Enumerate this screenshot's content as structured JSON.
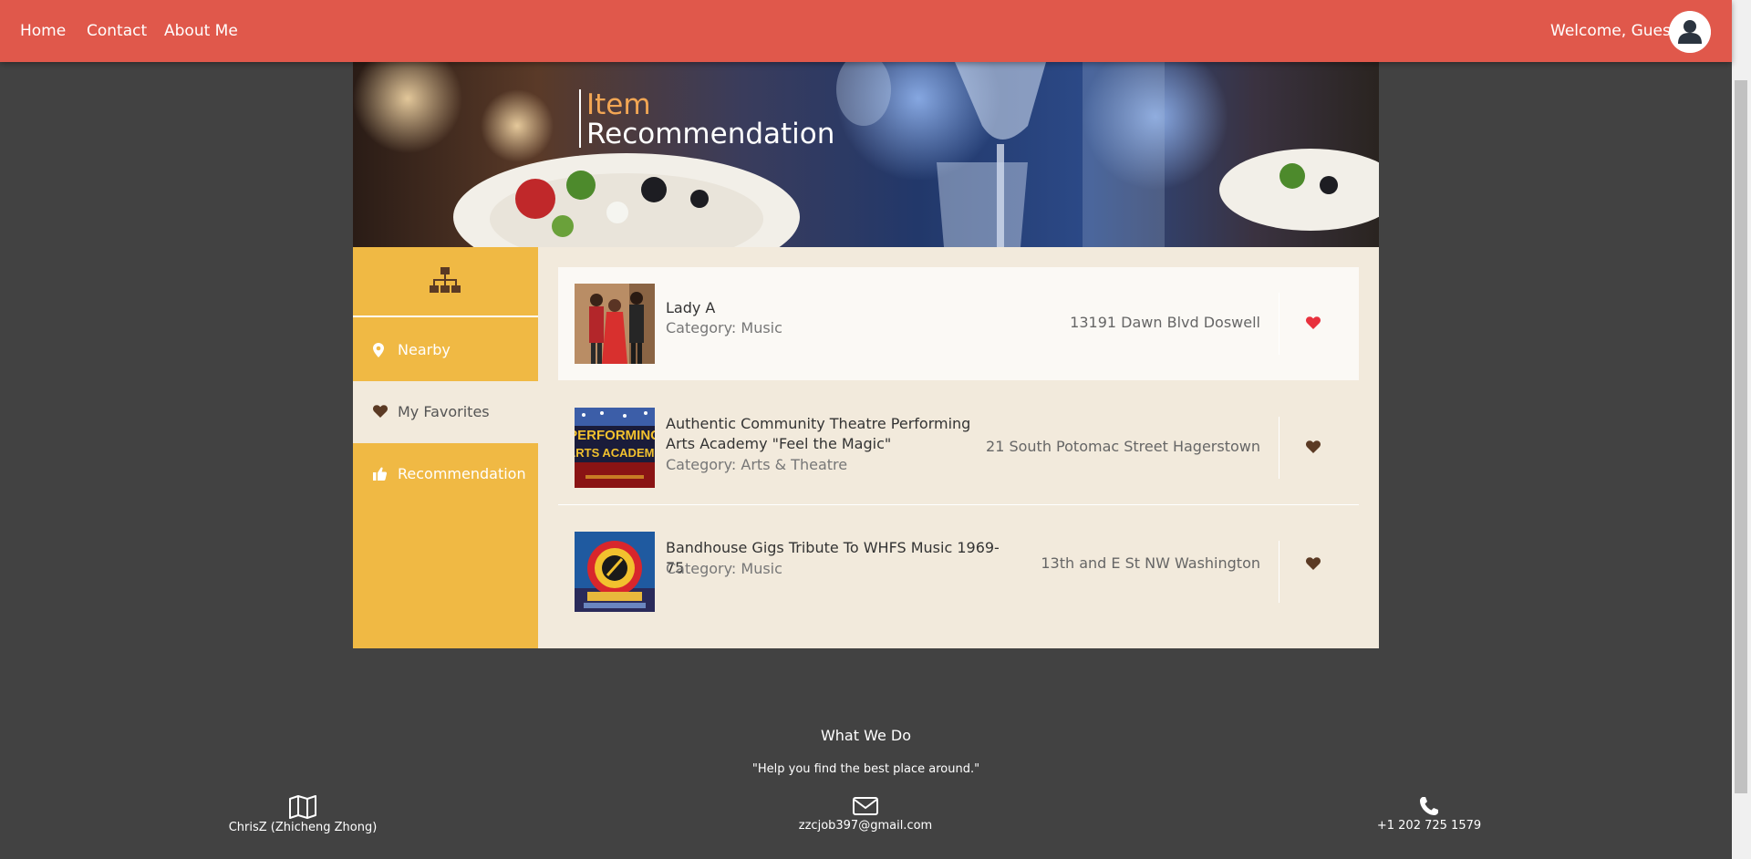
{
  "nav": {
    "links": [
      "Home",
      "Contact",
      "About Me"
    ],
    "welcome": "Welcome, Guest"
  },
  "hero": {
    "title_line1": "Item",
    "title_line2": "Recommendation"
  },
  "sidebar": {
    "header_icon": "sitemap-icon",
    "items": [
      {
        "label": "Nearby",
        "icon": "map-marker-icon",
        "active": false
      },
      {
        "label": "My Favorites",
        "icon": "heart-icon",
        "active": true
      },
      {
        "label": "Recommendation",
        "icon": "thumbs-up-icon",
        "active": false
      }
    ]
  },
  "items": [
    {
      "name": "Lady A",
      "category": "Category: Music",
      "address": "13191 Dawn Blvd Doswell",
      "favorite": true
    },
    {
      "name": "Authentic Community Theatre Performing Arts Academy \"Feel the Magic\"",
      "category": "Category: Arts & Theatre",
      "address": "21 South Potomac Street Hagerstown",
      "favorite": false
    },
    {
      "name": "Bandhouse Gigs Tribute To WHFS Music 1969-75",
      "category": "Category: Music",
      "address": "13th and E St NW Washington",
      "favorite": false
    }
  ],
  "thumb_texts": {
    "theatre_line1": "PERFORMING",
    "theatre_line2": "ARTS ACADEMY"
  },
  "footer": {
    "title": "What We Do",
    "quote": "\"Help you find the best place around.\"",
    "name": "ChrisZ (Zhicheng Zhong)",
    "email": "zzcjob397@gmail.com",
    "phone": "+1 202 725 1579"
  },
  "colors": {
    "nav_bg": "#e0584b",
    "sidebar_bg": "#f0b944",
    "content_bg": "#f2eadc",
    "page_bg": "#424242",
    "hero_accent": "#f2a654",
    "favorite_heart": "#e8313d",
    "heart_default": "#5b3a24"
  }
}
